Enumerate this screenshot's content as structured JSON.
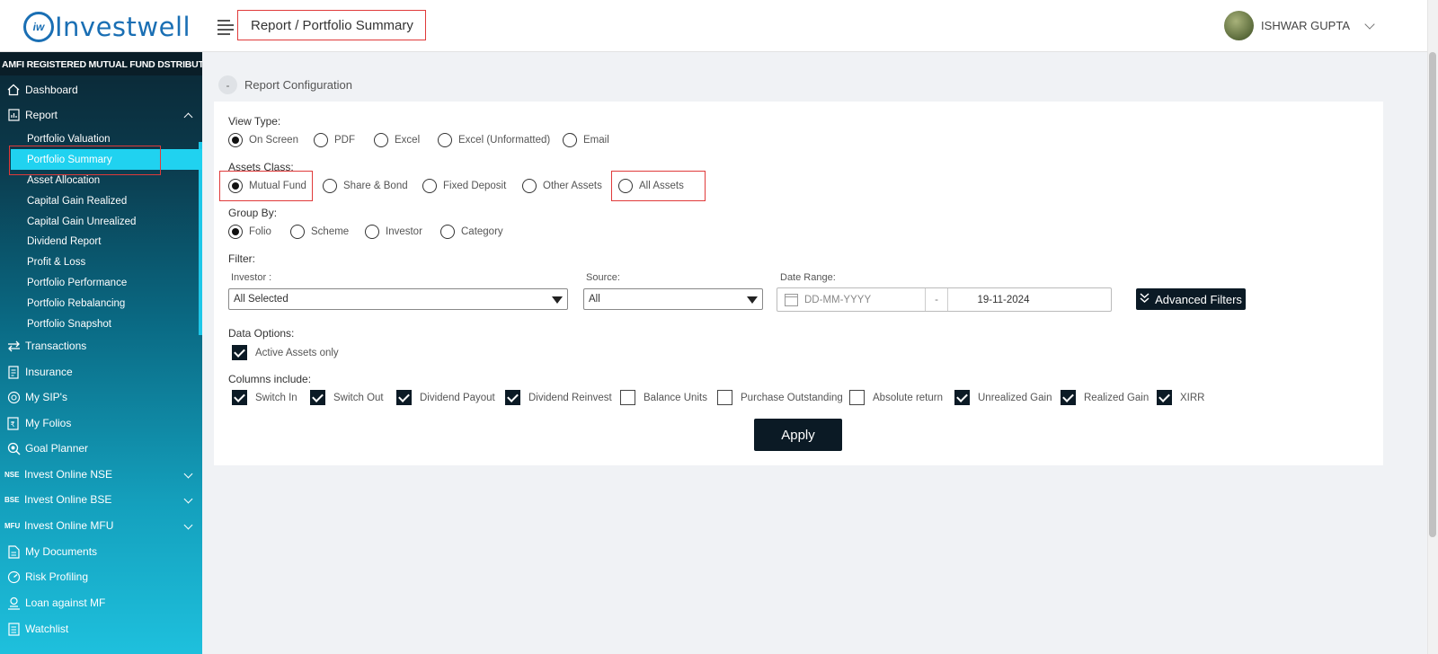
{
  "app": {
    "logo_mark": "iw",
    "logo_text": "Investwell"
  },
  "header": {
    "breadcrumb": "Report / Portfolio Summary",
    "user_name": "ISHWAR GUPTA"
  },
  "sidebar": {
    "heading": "AMFI REGISTERED MUTUAL FUND DSTRIBUTOR",
    "dashboard": "Dashboard",
    "report": "Report",
    "report_sub": [
      "Portfolio Valuation",
      "Portfolio Summary",
      "Asset Allocation",
      "Capital Gain Realized",
      "Capital Gain Unrealized",
      "Dividend Report",
      "Profit & Loss",
      "Portfolio Performance",
      "Portfolio Rebalancing",
      "Portfolio Snapshot"
    ],
    "transactions": "Transactions",
    "insurance": "Insurance",
    "my_sips": "My SIP's",
    "my_folios": "My Folios",
    "goal_planner": "Goal Planner",
    "nse_tag": "NSE",
    "invest_nse": "Invest Online NSE",
    "bse_tag": "BSE",
    "invest_bse": "Invest Online BSE",
    "mfu_tag": "MFU",
    "invest_mfu": "Invest Online MFU",
    "my_documents": "My Documents",
    "risk_profiling": "Risk Profiling",
    "loan_against_mf": "Loan against MF",
    "watchlist": "Watchlist"
  },
  "config": {
    "toggle": "-",
    "title": "Report Configuration",
    "view_type": {
      "label": "View Type:",
      "options": [
        "On Screen",
        "PDF",
        "Excel",
        "Excel (Unformatted)",
        "Email"
      ],
      "selected": "On Screen"
    },
    "assets_class": {
      "label": "Assets Class:",
      "options": [
        "Mutual Fund",
        "Share & Bond",
        "Fixed Deposit",
        "Other Assets",
        "All Assets"
      ],
      "selected": "Mutual Fund"
    },
    "group_by": {
      "label": "Group By:",
      "options": [
        "Folio",
        "Scheme",
        "Investor",
        "Category"
      ],
      "selected": "Folio"
    },
    "filter": {
      "label": "Filter:",
      "investor_label": "Investor :",
      "investor_value": "All Selected",
      "source_label": "Source:",
      "source_value": "All",
      "date_label": "Date Range:",
      "date_from_placeholder": "DD-MM-YYYY",
      "date_sep": "-",
      "date_to": "19-11-2024",
      "advanced": "Advanced Filters"
    },
    "data_options": {
      "label": "Data Options:",
      "active_assets": "Active Assets only",
      "active_checked": true
    },
    "columns": {
      "label": "Columns include:",
      "items": [
        {
          "label": "Switch In",
          "checked": true
        },
        {
          "label": "Switch Out",
          "checked": true
        },
        {
          "label": "Dividend Payout",
          "checked": true
        },
        {
          "label": "Dividend Reinvest",
          "checked": true
        },
        {
          "label": "Balance Units",
          "checked": false
        },
        {
          "label": "Purchase Outstanding",
          "checked": false
        },
        {
          "label": "Absolute return",
          "checked": false
        },
        {
          "label": "Unrealized Gain",
          "checked": true
        },
        {
          "label": "Realized Gain",
          "checked": true
        },
        {
          "label": "XIRR",
          "checked": true
        }
      ]
    },
    "apply": "Apply"
  }
}
